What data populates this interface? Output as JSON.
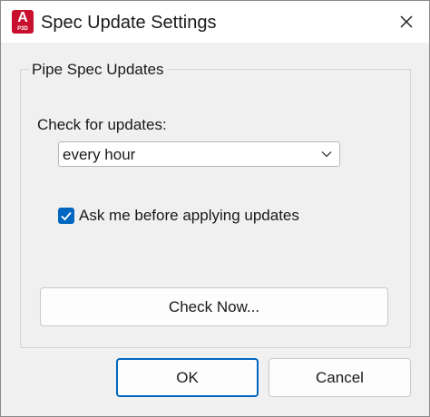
{
  "window": {
    "title": "Spec Update Settings",
    "app_icon": {
      "letter": "A",
      "subtext": "P3D",
      "color": "#c8102e"
    },
    "close_icon": "close-icon"
  },
  "group": {
    "label": "Pipe Spec Updates",
    "check_for_updates_label": "Check for updates:",
    "frequency_select": {
      "value": "every hour",
      "icon": "chevron-down-icon"
    },
    "ask_before_applying": {
      "label": "Ask me before applying updates",
      "checked": true,
      "color": "#0067c0"
    },
    "check_now_label": "Check Now..."
  },
  "footer": {
    "ok_label": "OK",
    "cancel_label": "Cancel"
  }
}
